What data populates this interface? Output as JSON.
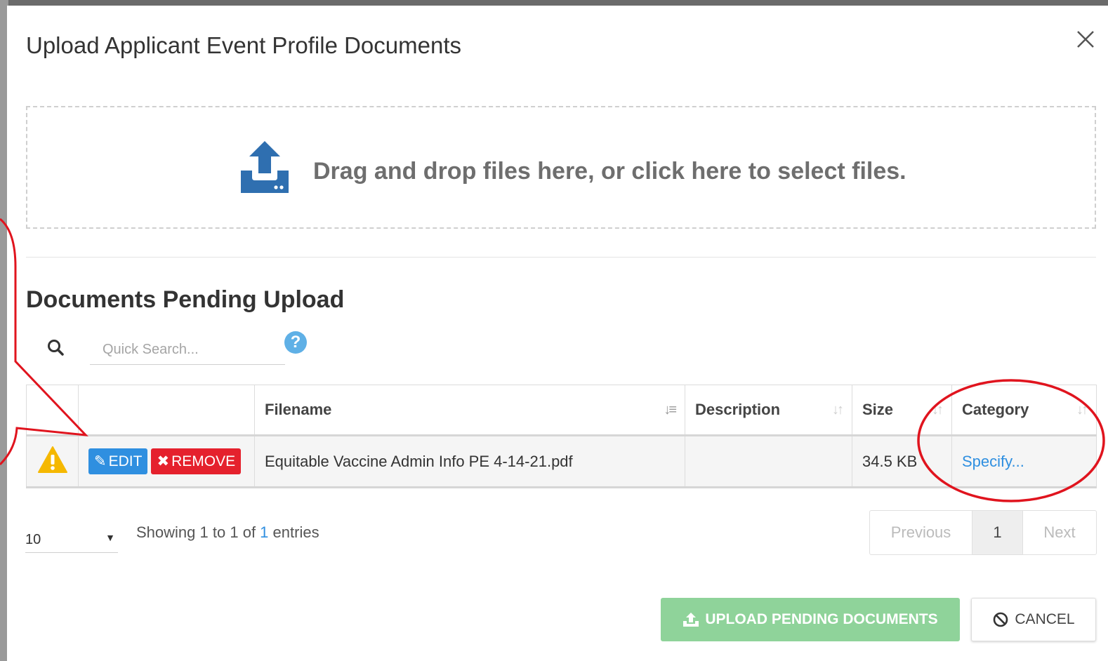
{
  "modal": {
    "title": "Upload Applicant Event Profile Documents",
    "close_icon": "close-icon"
  },
  "dropzone": {
    "icon": "upload-tray-icon",
    "text": "Drag and drop files here, or click here to select files."
  },
  "pending": {
    "title": "Documents Pending Upload",
    "search_placeholder": "Quick Search...",
    "search_icon": "search-icon",
    "help_icon": "help-circle-icon",
    "help_label": "?"
  },
  "table": {
    "columns": [
      "",
      "",
      "Filename",
      "Description",
      "Size",
      "Category"
    ],
    "rows": [
      {
        "status_icon": "warning-icon",
        "edit_label": "EDIT",
        "remove_label": "REMOVE",
        "filename": "Equitable Vaccine Admin Info PE 4-14-21.pdf",
        "description": "",
        "size": "34.5 KB",
        "category": "Specify..."
      }
    ]
  },
  "footer": {
    "page_length": "10",
    "info_prefix": "Showing ",
    "info_from": "1",
    "info_to_word": " to ",
    "info_to": "1",
    "info_of_word": " of ",
    "info_total": "1",
    "info_suffix": " entries",
    "previous_label": "Previous",
    "current_page": "1",
    "next_label": "Next"
  },
  "actions": {
    "upload_label": "UPLOAD PENDING DOCUMENTS",
    "cancel_label": "CANCEL"
  },
  "colors": {
    "primary": "#2f8fe0",
    "danger": "#e5212d",
    "success_disabled": "#8fd39a",
    "warning": "#f5b800",
    "annotation": "#e0141e"
  },
  "annotations": {
    "callout": "red-speech-callout",
    "circle": "red-circle-highlight"
  }
}
